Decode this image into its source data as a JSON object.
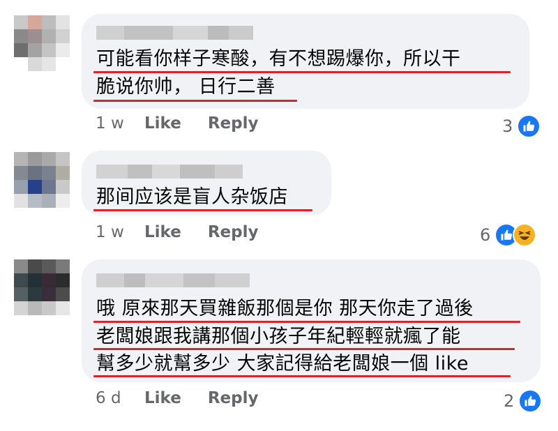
{
  "comments": [
    {
      "lines": [
        "可能看你样子寒酸，有不想踢爆你，所以干",
        "脆说你帅， 日行二善"
      ],
      "time": "1 w",
      "like_label": "Like",
      "reply_label": "Reply",
      "reaction_count": "3",
      "reactions": [
        "like-icon"
      ]
    },
    {
      "lines": [
        "那间应该是盲人杂饭店"
      ],
      "time": "1 w",
      "like_label": "Like",
      "reply_label": "Reply",
      "reaction_count": "6",
      "reactions": [
        "like-icon",
        "haha-icon"
      ]
    },
    {
      "lines": [
        "哦 原來那天買雜飯那個是你 那天你走了過後",
        "老闆娘跟我講那個小孩子年紀輕輕就瘋了能",
        "幫多少就幫多少 大家記得給老闆娘一個 like"
      ],
      "time": "6 d",
      "like_label": "Like",
      "reply_label": "Reply",
      "reaction_count": "2",
      "reactions": [
        "like-icon"
      ]
    }
  ],
  "colors": {
    "bubble": "#f0f2f5",
    "underline": "#d6262c",
    "like_blue": "#1877f2",
    "haha_yellow": "#f7b125",
    "meta_gray": "#65676b"
  }
}
